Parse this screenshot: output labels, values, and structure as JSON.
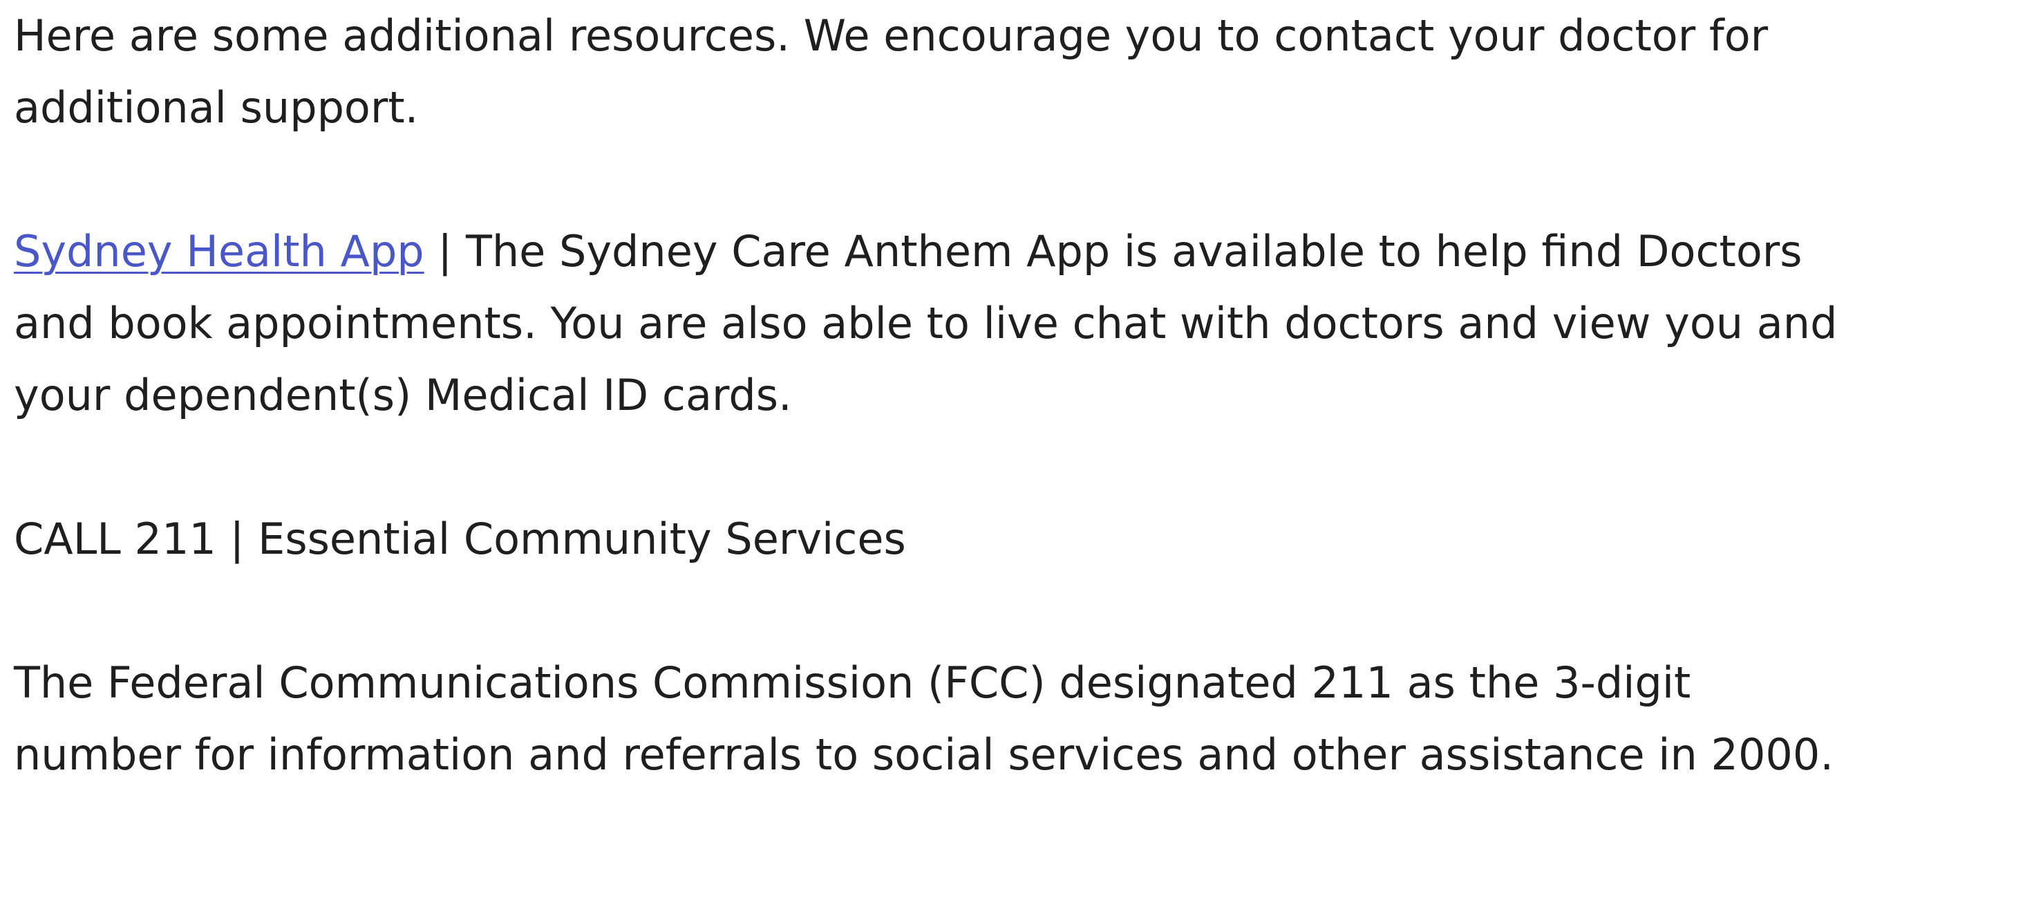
{
  "intro": {
    "line1": "Here are some additional resources. We encourage you to contact your doctor for",
    "line2": "additional support."
  },
  "sydney": {
    "link_text": "Sydney Health App",
    "line1_rest": " | The Sydney Care Anthem App is available to help find Doctors",
    "line2": "and book appointments. You are also able to live chat with doctors and view you and",
    "line3": "your dependent(s) Medical ID cards."
  },
  "call211": {
    "heading": "CALL 211 | Essential Community Services"
  },
  "fcc": {
    "line1": "The Federal Communications Commission (FCC) designated 211 as the 3-digit",
    "line2": "number for information and referrals to social services and other assistance in 2000."
  },
  "colors": {
    "link": "#4a57c9",
    "text": "#1f1f1f",
    "background": "#ffffff"
  }
}
